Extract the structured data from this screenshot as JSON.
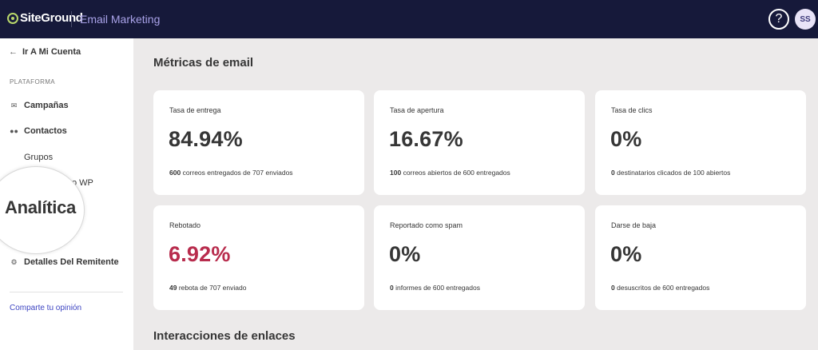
{
  "header": {
    "logo_text": "SiteGround",
    "app_name": "Email Marketing",
    "help_label": "?",
    "avatar_initials": "SS"
  },
  "sidebar": {
    "back_label": "Ir A Mi Cuenta",
    "section_label": "PLATAFORMA",
    "items": [
      {
        "label": "Campañas",
        "icon": "envelope-icon"
      },
      {
        "label": "Contactos",
        "icon": "contacts-icon"
      }
    ],
    "sub_items": [
      "Grupos",
      "o WP"
    ],
    "settings_item": {
      "label": "Detalles Del Remitente",
      "icon": "gear-icon"
    },
    "feedback_label": "Comparte tu opinión"
  },
  "magnifier": {
    "text": "Analítica"
  },
  "main": {
    "title": "Métricas de email",
    "section2_title": "Interacciones de enlaces",
    "cards": [
      {
        "label": "Tasa de entrega",
        "value": "84.94%",
        "count": "600",
        "foot": "correos entregados de 707 enviados",
        "status": "normal"
      },
      {
        "label": "Tasa de apertura",
        "value": "16.67%",
        "count": "100",
        "foot": "correos abiertos de 600 entregados",
        "status": "normal"
      },
      {
        "label": "Tasa de clics",
        "value": "0%",
        "count": "0",
        "foot": "destinatarios clicados de 100 abiertos",
        "status": "normal"
      },
      {
        "label": "Rebotado",
        "value": "6.92%",
        "count": "49",
        "foot": "rebota de 707 enviado",
        "status": "danger"
      },
      {
        "label": "Reportado como spam",
        "value": "0%",
        "count": "0",
        "foot": "informes de 600 entregados",
        "status": "normal"
      },
      {
        "label": "Darse de baja",
        "value": "0%",
        "count": "0",
        "foot": "desuscritos de 600 entregados",
        "status": "normal"
      }
    ]
  },
  "colors": {
    "topbar": "#16193a",
    "accent": "#a9a2e8",
    "danger": "#b82c4d",
    "link": "#3e45c2"
  }
}
